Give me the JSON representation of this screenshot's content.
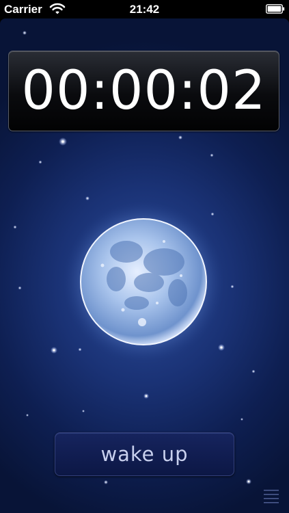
{
  "status_bar": {
    "carrier": "Carrier",
    "time": "21:42"
  },
  "timer": {
    "display": "00:00:02"
  },
  "wake_button": {
    "label": "wake up"
  },
  "icons": {
    "wifi": "wifi-icon",
    "battery": "battery-icon",
    "moon": "moon-icon",
    "menu": "menu-icon"
  },
  "colors": {
    "sky_dark": "#081437",
    "sky_light": "#2b4c9a",
    "button_bg": "#12205a",
    "button_text": "#c8d0ee",
    "timer_text": "#ffffff"
  }
}
